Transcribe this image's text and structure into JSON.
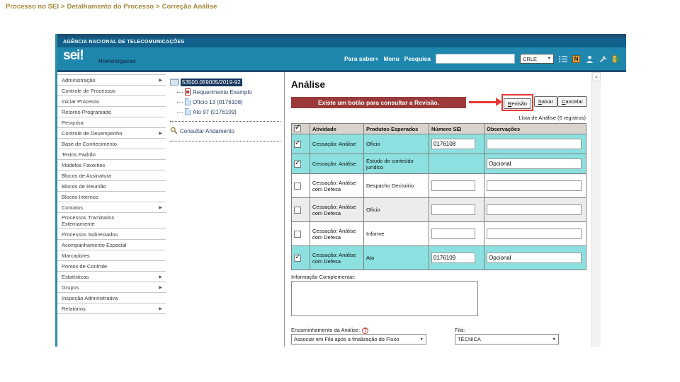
{
  "breadcrumb": {
    "items": [
      "Processo no SEI",
      "Detalhamento do Processo",
      "Correção Análise"
    ],
    "separator": ">"
  },
  "icons": {
    "submenu_arrow": "▶",
    "dropdown_arrow": "▼",
    "scroll_up_arrow": "▲",
    "check": "✓",
    "question": "?"
  },
  "header": {
    "agency": "AGÊNCIA NACIONAL DE TELECOMUNICAÇÕES",
    "logo": "sei!",
    "environment": "Homologacao",
    "menu": [
      "Para saber+",
      "Menu",
      "Pesquisa"
    ],
    "search_value": "",
    "unit_value": "CRLE",
    "notes_icon_label": "N"
  },
  "sidebar": {
    "items": [
      {
        "label": "Administração",
        "has_submenu": true
      },
      {
        "label": "Controle de Processos",
        "has_submenu": false
      },
      {
        "label": "Iniciar Processo",
        "has_submenu": false
      },
      {
        "label": "Retorno Programado",
        "has_submenu": false
      },
      {
        "label": "Pesquisa",
        "has_submenu": false
      },
      {
        "label": "Controle de Desempenho",
        "has_submenu": true
      },
      {
        "label": "Base de Conhecimento",
        "has_submenu": false
      },
      {
        "label": "Textos Padrão",
        "has_submenu": false
      },
      {
        "label": "Modelos Favoritos",
        "has_submenu": false
      },
      {
        "label": "Blocos de Assinatura",
        "has_submenu": false
      },
      {
        "label": "Blocos de Reunião",
        "has_submenu": false
      },
      {
        "label": "Blocos Internos",
        "has_submenu": false
      },
      {
        "label": "Contatos",
        "has_submenu": true
      },
      {
        "label": "Processos Tramitados Externamente",
        "has_submenu": false
      },
      {
        "label": "Processos Sobrestados",
        "has_submenu": false
      },
      {
        "label": "Acompanhamento Especial",
        "has_submenu": false
      },
      {
        "label": "Marcadores",
        "has_submenu": false
      },
      {
        "label": "Pontos de Controle",
        "has_submenu": false
      },
      {
        "label": "Estatísticas",
        "has_submenu": true
      },
      {
        "label": "Grupos",
        "has_submenu": true
      },
      {
        "label": "Inspeção Administrativa",
        "has_submenu": false
      },
      {
        "label": "Relatórios",
        "has_submenu": true
      }
    ]
  },
  "tree": {
    "process_number": "53500.059005/2019-92",
    "documents": [
      {
        "label": "Requerimento Exemplo",
        "icon": "pdf-icon"
      },
      {
        "label": "Ofício 13 (0176108)",
        "icon": "document-icon"
      },
      {
        "label": "Ato 97 (0176109)",
        "icon": "document-icon"
      }
    ],
    "action_label": "Consultar Andamento"
  },
  "content": {
    "title": "Análise",
    "callout": "Existe um botão para consultar a Revisão.",
    "buttons": {
      "revisao": "Revisão",
      "salvar": "Salvar",
      "cancelar": "Cancelar"
    },
    "caption": "Lista de Análise (6 registros)",
    "table": {
      "select_all": true,
      "headers": [
        "Atividade",
        "Produtos Esperados",
        "Número SEI",
        "Observações"
      ],
      "rows": [
        {
          "checked": true,
          "highlight": true,
          "atividade": "Cessação: Análise",
          "produtos": "Ofício",
          "numero_sei": "0176108",
          "observacoes": ""
        },
        {
          "checked": true,
          "highlight": true,
          "atividade": "Cessação: Análise",
          "produtos": "Estudo de conteúdo jurídico",
          "numero_sei": "",
          "observacoes": "Opcional"
        },
        {
          "checked": false,
          "highlight": false,
          "atividade": "Cessação: Análise com Defesa",
          "produtos": "Despacho Decisório",
          "numero_sei": "",
          "observacoes": ""
        },
        {
          "checked": false,
          "highlight": false,
          "atividade": "Cessação: Análise com Defesa",
          "produtos": "Ofício",
          "numero_sei": "",
          "observacoes": ""
        },
        {
          "checked": false,
          "highlight": false,
          "atividade": "Cessação: Análise com Defesa",
          "produtos": "Informe",
          "numero_sei": "",
          "observacoes": ""
        },
        {
          "checked": true,
          "highlight": true,
          "atividade": "Cessação: Análise com Defesa",
          "produtos": "Ato",
          "numero_sei": "0176109",
          "observacoes": "Opcional"
        }
      ]
    },
    "info_label": "Informação Complementar:",
    "info_value": "",
    "forward_label": "Encaminhamento da Análise:",
    "forward_value": "Associar em Fila após a finalização do Fluxo",
    "queue_label": "Fila:",
    "queue_value": "TÉCNICA"
  },
  "colors": {
    "header_teal": "#1f87ae",
    "header_navy": "#11618c",
    "strip_navy": "#1d4f72",
    "callout_red": "#9c3a3a",
    "arrow_red": "#e53935",
    "row_highlight": "#8ce0e0",
    "selected_node": "#16365c",
    "breadcrumb_gold": "#a5883a"
  }
}
